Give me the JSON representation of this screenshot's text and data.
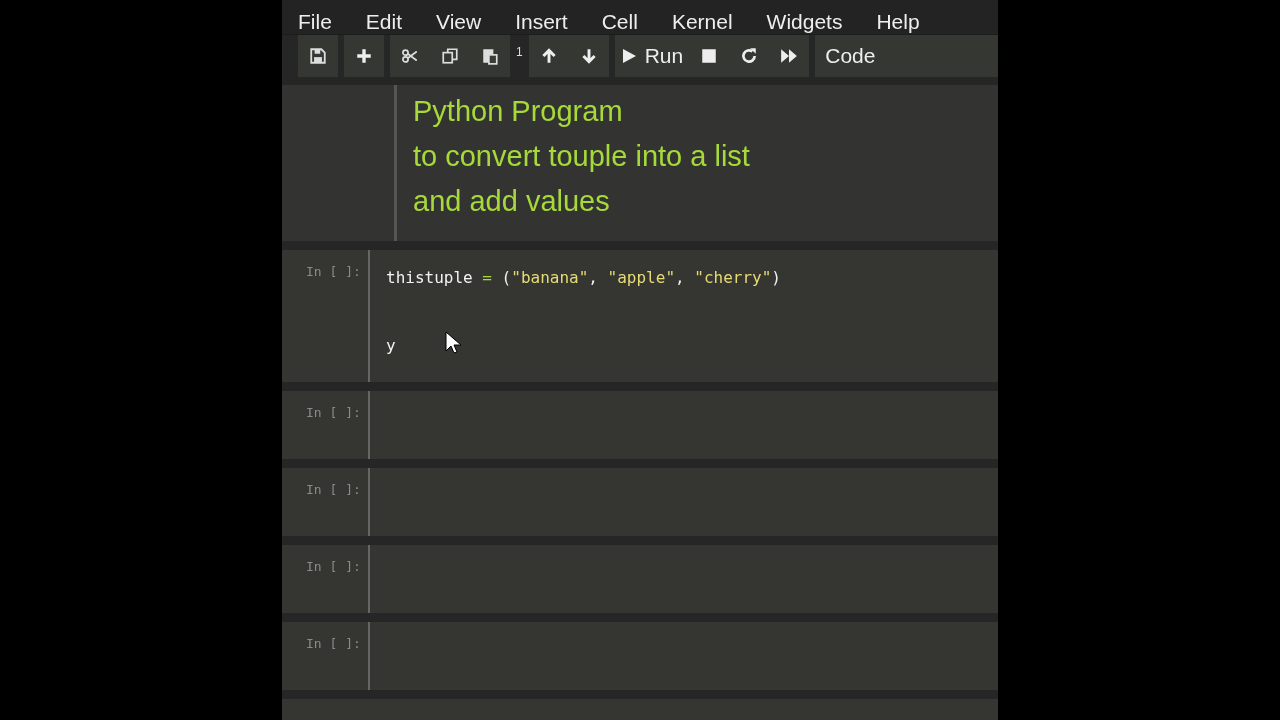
{
  "menu": [
    "File",
    "Edit",
    "View",
    "Insert",
    "Cell",
    "Kernel",
    "Widgets",
    "Help"
  ],
  "toolbar": {
    "groups": [
      {
        "buttons": [
          {
            "kind": "save"
          }
        ]
      },
      {
        "buttons": [
          {
            "kind": "add"
          }
        ]
      },
      {
        "buttons": [
          {
            "kind": "cut"
          },
          {
            "kind": "copy"
          },
          {
            "kind": "paste"
          }
        ]
      },
      {
        "buttons": [
          {
            "kind": "up"
          },
          {
            "kind": "down"
          }
        ]
      },
      {
        "buttons": [
          {
            "kind": "run"
          },
          {
            "kind": "stop"
          },
          {
            "kind": "restart"
          },
          {
            "kind": "fastforward"
          }
        ]
      }
    ],
    "badge": "1",
    "run_label": "Run",
    "cell_type": "Code"
  },
  "cells": [
    {
      "kind": "markdown",
      "lines": [
        "Python Program",
        "to convert touple into a list",
        "and add values"
      ]
    },
    {
      "kind": "code",
      "prompt": "In [ ]:",
      "lines": [
        {
          "tokens": [
            {
              "kind": "name",
              "text": "thistuple"
            },
            {
              "kind": "op",
              "text": " = "
            },
            {
              "kind": "punct",
              "text": "("
            },
            {
              "kind": "string",
              "text": "\"banana\""
            },
            {
              "kind": "punct",
              "text": ", "
            },
            {
              "kind": "string",
              "text": "\"apple\""
            },
            {
              "kind": "punct",
              "text": ", "
            },
            {
              "kind": "string",
              "text": "\"cherry\""
            },
            {
              "kind": "punct",
              "text": ")"
            }
          ]
        },
        {
          "tokens": [
            {
              "kind": "name",
              "text": "y"
            }
          ]
        }
      ]
    },
    {
      "kind": "code",
      "prompt": "In [ ]:"
    },
    {
      "kind": "code",
      "prompt": "In [ ]:"
    },
    {
      "kind": "code",
      "prompt": "In [ ]:"
    },
    {
      "kind": "code",
      "prompt": "In [ ]:"
    }
  ]
}
